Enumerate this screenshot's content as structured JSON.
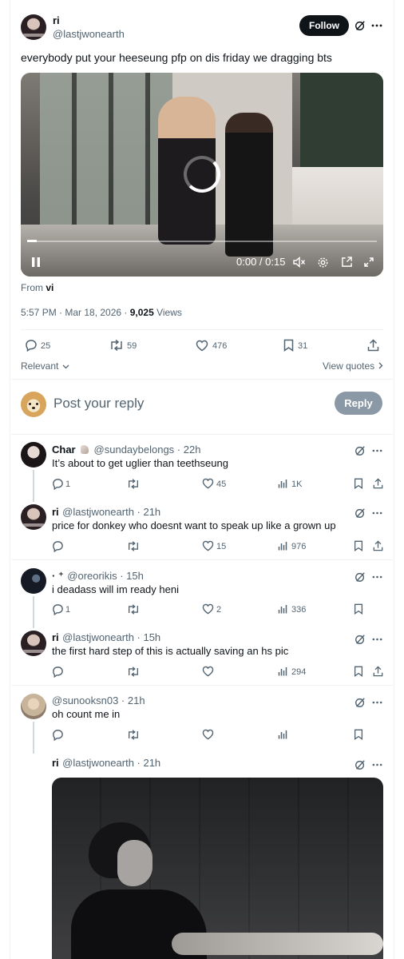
{
  "main_tweet": {
    "display_name": "ri",
    "handle": "@lastjwonearth",
    "follow_label": "Follow",
    "text": "everybody put your heeseung pfp on dis friday we dragging bts",
    "video": {
      "time": "0:00 / 0:15",
      "progress_fraction": 0.0
    },
    "from_prefix": "From",
    "from_name": "vi",
    "timestamp": "5:57 PM · Mar 18, 2026 · ",
    "views_count": "9,025",
    "views_label": " Views",
    "stats": {
      "replies": "25",
      "reposts": "59",
      "likes": "476",
      "bookmarks": "31"
    },
    "sort_label": "Relevant",
    "view_quotes": "View quotes"
  },
  "composer": {
    "placeholder": "Post your reply",
    "reply_button": "Reply"
  },
  "replies": [
    {
      "display_name": "Char",
      "handle": "@sundaybelongs · 22h",
      "text": "It’s about to get uglier than teethseung",
      "replies": "1",
      "likes": "45",
      "views": "1K"
    },
    {
      "display_name": "ri",
      "handle": "@lastjwonearth · 21h",
      "text": "price for donkey who doesnt want to speak up like a grown up",
      "likes": "15",
      "views": "976"
    },
    {
      "display_name": "· ⁺",
      "handle": "@oreorikis · 15h",
      "text": "i deadass will im ready heni",
      "replies": "1",
      "likes": "2",
      "views": "336"
    },
    {
      "display_name": "ri",
      "handle": "@lastjwonearth · 15h",
      "text": "the first hard step of this is actually saving an hs  pic",
      "views": "294"
    },
    {
      "handle": "@sunooksn03 · 21h",
      "text": "oh count me in"
    },
    {
      "display_name": "ri",
      "handle": "@lastjwonearth · 21h"
    }
  ],
  "colors": {
    "follow_bg": "#0f1419",
    "reply_button_bg": "#8b98a5",
    "muted_text": "#536471",
    "divider": "#eff3f4"
  }
}
